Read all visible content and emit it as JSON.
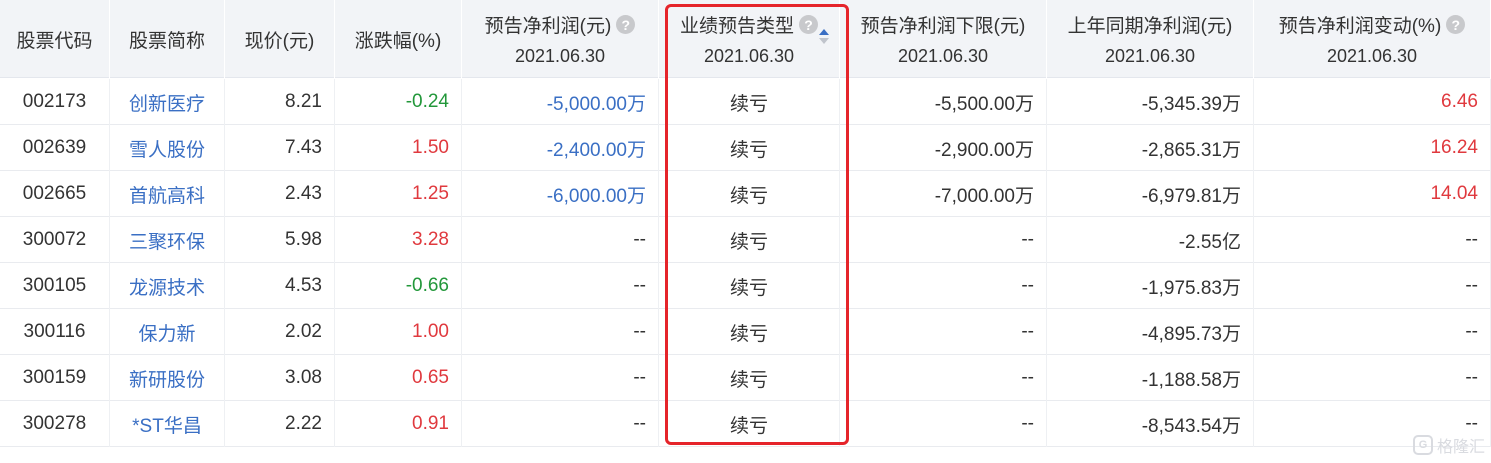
{
  "headers": [
    {
      "l1": "股票代码",
      "l2": ""
    },
    {
      "l1": "股票简称",
      "l2": ""
    },
    {
      "l1": "现价(元)",
      "l2": ""
    },
    {
      "l1": "涨跌幅(%)",
      "l2": ""
    },
    {
      "l1": "预告净利润(元)",
      "l2": "2021.06.30"
    },
    {
      "l1": "业绩预告类型",
      "l2": "2021.06.30"
    },
    {
      "l1": "预告净利润下限(元)",
      "l2": "2021.06.30"
    },
    {
      "l1": "上年同期净利润(元)",
      "l2": "2021.06.30"
    },
    {
      "l1": "预告净利润变动(%)",
      "l2": "2021.06.30"
    }
  ],
  "rows": [
    {
      "code": "002173",
      "name": "创新医疗",
      "price": "8.21",
      "change": "-0.24",
      "profit": "-5,000.00万",
      "type": "续亏",
      "lower": "-5,500.00万",
      "last": "-5,345.39万",
      "delta": "6.46"
    },
    {
      "code": "002639",
      "name": "雪人股份",
      "price": "7.43",
      "change": "1.50",
      "profit": "-2,400.00万",
      "type": "续亏",
      "lower": "-2,900.00万",
      "last": "-2,865.31万",
      "delta": "16.24"
    },
    {
      "code": "002665",
      "name": "首航高科",
      "price": "2.43",
      "change": "1.25",
      "profit": "-6,000.00万",
      "type": "续亏",
      "lower": "-7,000.00万",
      "last": "-6,979.81万",
      "delta": "14.04"
    },
    {
      "code": "300072",
      "name": "三聚环保",
      "price": "5.98",
      "change": "3.28",
      "profit": "--",
      "type": "续亏",
      "lower": "--",
      "last": "-2.55亿",
      "delta": "--"
    },
    {
      "code": "300105",
      "name": "龙源技术",
      "price": "4.53",
      "change": "-0.66",
      "profit": "--",
      "type": "续亏",
      "lower": "--",
      "last": "-1,975.83万",
      "delta": "--"
    },
    {
      "code": "300116",
      "name": "保力新",
      "price": "2.02",
      "change": "1.00",
      "profit": "--",
      "type": "续亏",
      "lower": "--",
      "last": "-4,895.73万",
      "delta": "--"
    },
    {
      "code": "300159",
      "name": "新研股份",
      "price": "3.08",
      "change": "0.65",
      "profit": "--",
      "type": "续亏",
      "lower": "--",
      "last": "-1,188.58万",
      "delta": "--"
    },
    {
      "code": "300278",
      "name": "*ST华昌",
      "price": "2.22",
      "change": "0.91",
      "profit": "--",
      "type": "续亏",
      "lower": "--",
      "last": "-8,543.54万",
      "delta": "--"
    }
  ],
  "colors": {
    "up": "#e0393e",
    "down": "#22973a",
    "link": "#3a6fc4",
    "highlight": "#e5242a"
  },
  "watermark": "格隆汇"
}
